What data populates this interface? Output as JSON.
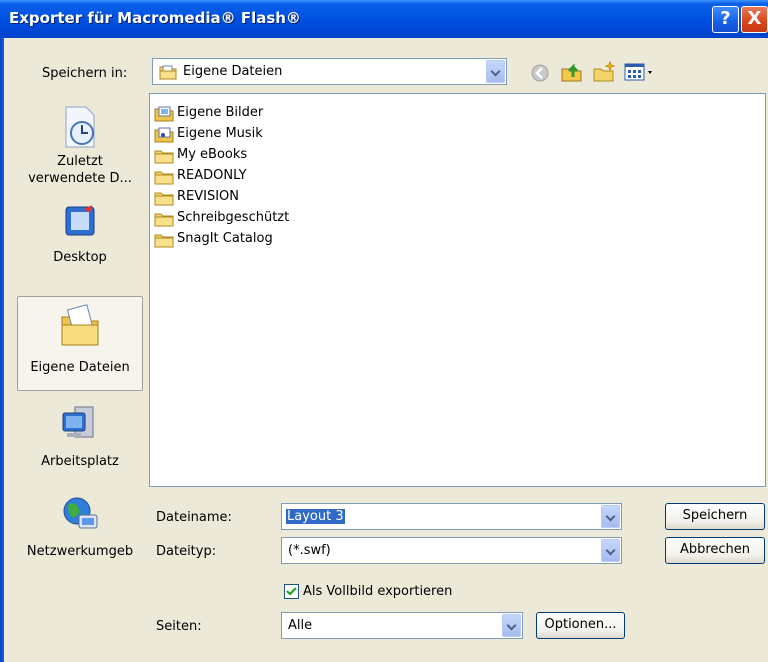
{
  "window": {
    "title": "Exporter für Macromedia® Flash®",
    "help_glyph": "?",
    "close_glyph": "X"
  },
  "save_in": {
    "label": "Speichern in:",
    "value": "Eigene Dateien"
  },
  "places": [
    {
      "label": "Zuletzt verwendete D..."
    },
    {
      "label": "Desktop"
    },
    {
      "label": "Eigene Dateien"
    },
    {
      "label": "Arbeitsplatz"
    },
    {
      "label": "Netzwerkumgeb"
    }
  ],
  "files": [
    {
      "name": "Eigene Bilder",
      "icon": "pictures-folder-icon"
    },
    {
      "name": "Eigene Musik",
      "icon": "music-folder-icon"
    },
    {
      "name": "My eBooks",
      "icon": "folder-icon"
    },
    {
      "name": "READONLY",
      "icon": "folder-icon"
    },
    {
      "name": "REVISION",
      "icon": "folder-icon"
    },
    {
      "name": "Schreibgeschützt",
      "icon": "folder-icon"
    },
    {
      "name": "SnagIt Catalog",
      "icon": "folder-icon"
    }
  ],
  "filename": {
    "label": "Dateiname:",
    "value": "Layout 3"
  },
  "filetype": {
    "label": "Dateityp:",
    "value": "(*.swf)"
  },
  "fullscreen": {
    "label": "Als Vollbild exportieren",
    "checked": true
  },
  "pages": {
    "label": "Seiten:",
    "value": "Alle"
  },
  "buttons": {
    "save": "Speichern",
    "cancel": "Abbrechen",
    "options": "Optionen..."
  },
  "colors": {
    "titlebar": "#0054e3",
    "face": "#ece9d8",
    "selection": "#316ac5"
  }
}
